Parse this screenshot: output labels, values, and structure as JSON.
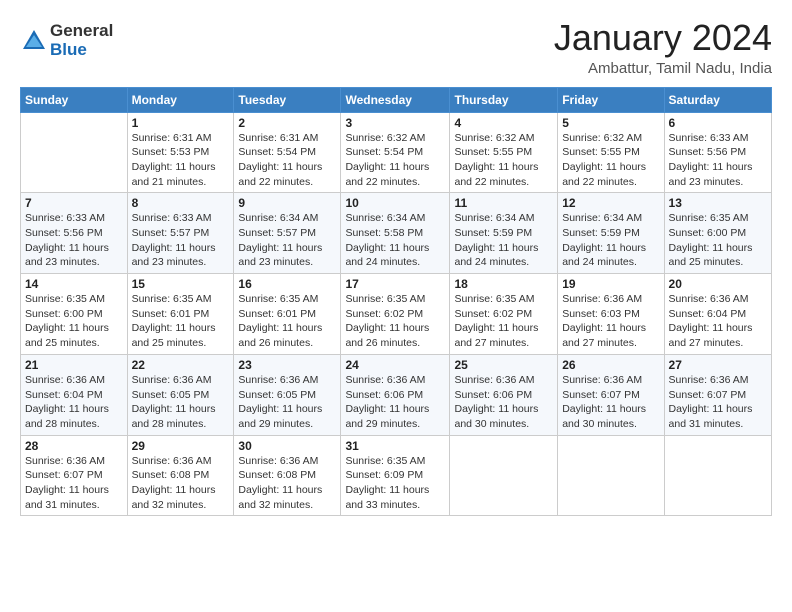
{
  "logo": {
    "general": "General",
    "blue": "Blue"
  },
  "header": {
    "month": "January 2024",
    "location": "Ambattur, Tamil Nadu, India"
  },
  "weekdays": [
    "Sunday",
    "Monday",
    "Tuesday",
    "Wednesday",
    "Thursday",
    "Friday",
    "Saturday"
  ],
  "weeks": [
    [
      {
        "day": "",
        "info": ""
      },
      {
        "day": "1",
        "info": "Sunrise: 6:31 AM\nSunset: 5:53 PM\nDaylight: 11 hours\nand 21 minutes."
      },
      {
        "day": "2",
        "info": "Sunrise: 6:31 AM\nSunset: 5:54 PM\nDaylight: 11 hours\nand 22 minutes."
      },
      {
        "day": "3",
        "info": "Sunrise: 6:32 AM\nSunset: 5:54 PM\nDaylight: 11 hours\nand 22 minutes."
      },
      {
        "day": "4",
        "info": "Sunrise: 6:32 AM\nSunset: 5:55 PM\nDaylight: 11 hours\nand 22 minutes."
      },
      {
        "day": "5",
        "info": "Sunrise: 6:32 AM\nSunset: 5:55 PM\nDaylight: 11 hours\nand 22 minutes."
      },
      {
        "day": "6",
        "info": "Sunrise: 6:33 AM\nSunset: 5:56 PM\nDaylight: 11 hours\nand 23 minutes."
      }
    ],
    [
      {
        "day": "7",
        "info": "Sunrise: 6:33 AM\nSunset: 5:56 PM\nDaylight: 11 hours\nand 23 minutes."
      },
      {
        "day": "8",
        "info": "Sunrise: 6:33 AM\nSunset: 5:57 PM\nDaylight: 11 hours\nand 23 minutes."
      },
      {
        "day": "9",
        "info": "Sunrise: 6:34 AM\nSunset: 5:57 PM\nDaylight: 11 hours\nand 23 minutes."
      },
      {
        "day": "10",
        "info": "Sunrise: 6:34 AM\nSunset: 5:58 PM\nDaylight: 11 hours\nand 24 minutes."
      },
      {
        "day": "11",
        "info": "Sunrise: 6:34 AM\nSunset: 5:59 PM\nDaylight: 11 hours\nand 24 minutes."
      },
      {
        "day": "12",
        "info": "Sunrise: 6:34 AM\nSunset: 5:59 PM\nDaylight: 11 hours\nand 24 minutes."
      },
      {
        "day": "13",
        "info": "Sunrise: 6:35 AM\nSunset: 6:00 PM\nDaylight: 11 hours\nand 25 minutes."
      }
    ],
    [
      {
        "day": "14",
        "info": "Sunrise: 6:35 AM\nSunset: 6:00 PM\nDaylight: 11 hours\nand 25 minutes."
      },
      {
        "day": "15",
        "info": "Sunrise: 6:35 AM\nSunset: 6:01 PM\nDaylight: 11 hours\nand 25 minutes."
      },
      {
        "day": "16",
        "info": "Sunrise: 6:35 AM\nSunset: 6:01 PM\nDaylight: 11 hours\nand 26 minutes."
      },
      {
        "day": "17",
        "info": "Sunrise: 6:35 AM\nSunset: 6:02 PM\nDaylight: 11 hours\nand 26 minutes."
      },
      {
        "day": "18",
        "info": "Sunrise: 6:35 AM\nSunset: 6:02 PM\nDaylight: 11 hours\nand 27 minutes."
      },
      {
        "day": "19",
        "info": "Sunrise: 6:36 AM\nSunset: 6:03 PM\nDaylight: 11 hours\nand 27 minutes."
      },
      {
        "day": "20",
        "info": "Sunrise: 6:36 AM\nSunset: 6:04 PM\nDaylight: 11 hours\nand 27 minutes."
      }
    ],
    [
      {
        "day": "21",
        "info": "Sunrise: 6:36 AM\nSunset: 6:04 PM\nDaylight: 11 hours\nand 28 minutes."
      },
      {
        "day": "22",
        "info": "Sunrise: 6:36 AM\nSunset: 6:05 PM\nDaylight: 11 hours\nand 28 minutes."
      },
      {
        "day": "23",
        "info": "Sunrise: 6:36 AM\nSunset: 6:05 PM\nDaylight: 11 hours\nand 29 minutes."
      },
      {
        "day": "24",
        "info": "Sunrise: 6:36 AM\nSunset: 6:06 PM\nDaylight: 11 hours\nand 29 minutes."
      },
      {
        "day": "25",
        "info": "Sunrise: 6:36 AM\nSunset: 6:06 PM\nDaylight: 11 hours\nand 30 minutes."
      },
      {
        "day": "26",
        "info": "Sunrise: 6:36 AM\nSunset: 6:07 PM\nDaylight: 11 hours\nand 30 minutes."
      },
      {
        "day": "27",
        "info": "Sunrise: 6:36 AM\nSunset: 6:07 PM\nDaylight: 11 hours\nand 31 minutes."
      }
    ],
    [
      {
        "day": "28",
        "info": "Sunrise: 6:36 AM\nSunset: 6:07 PM\nDaylight: 11 hours\nand 31 minutes."
      },
      {
        "day": "29",
        "info": "Sunrise: 6:36 AM\nSunset: 6:08 PM\nDaylight: 11 hours\nand 32 minutes."
      },
      {
        "day": "30",
        "info": "Sunrise: 6:36 AM\nSunset: 6:08 PM\nDaylight: 11 hours\nand 32 minutes."
      },
      {
        "day": "31",
        "info": "Sunrise: 6:35 AM\nSunset: 6:09 PM\nDaylight: 11 hours\nand 33 minutes."
      },
      {
        "day": "",
        "info": ""
      },
      {
        "day": "",
        "info": ""
      },
      {
        "day": "",
        "info": ""
      }
    ]
  ]
}
